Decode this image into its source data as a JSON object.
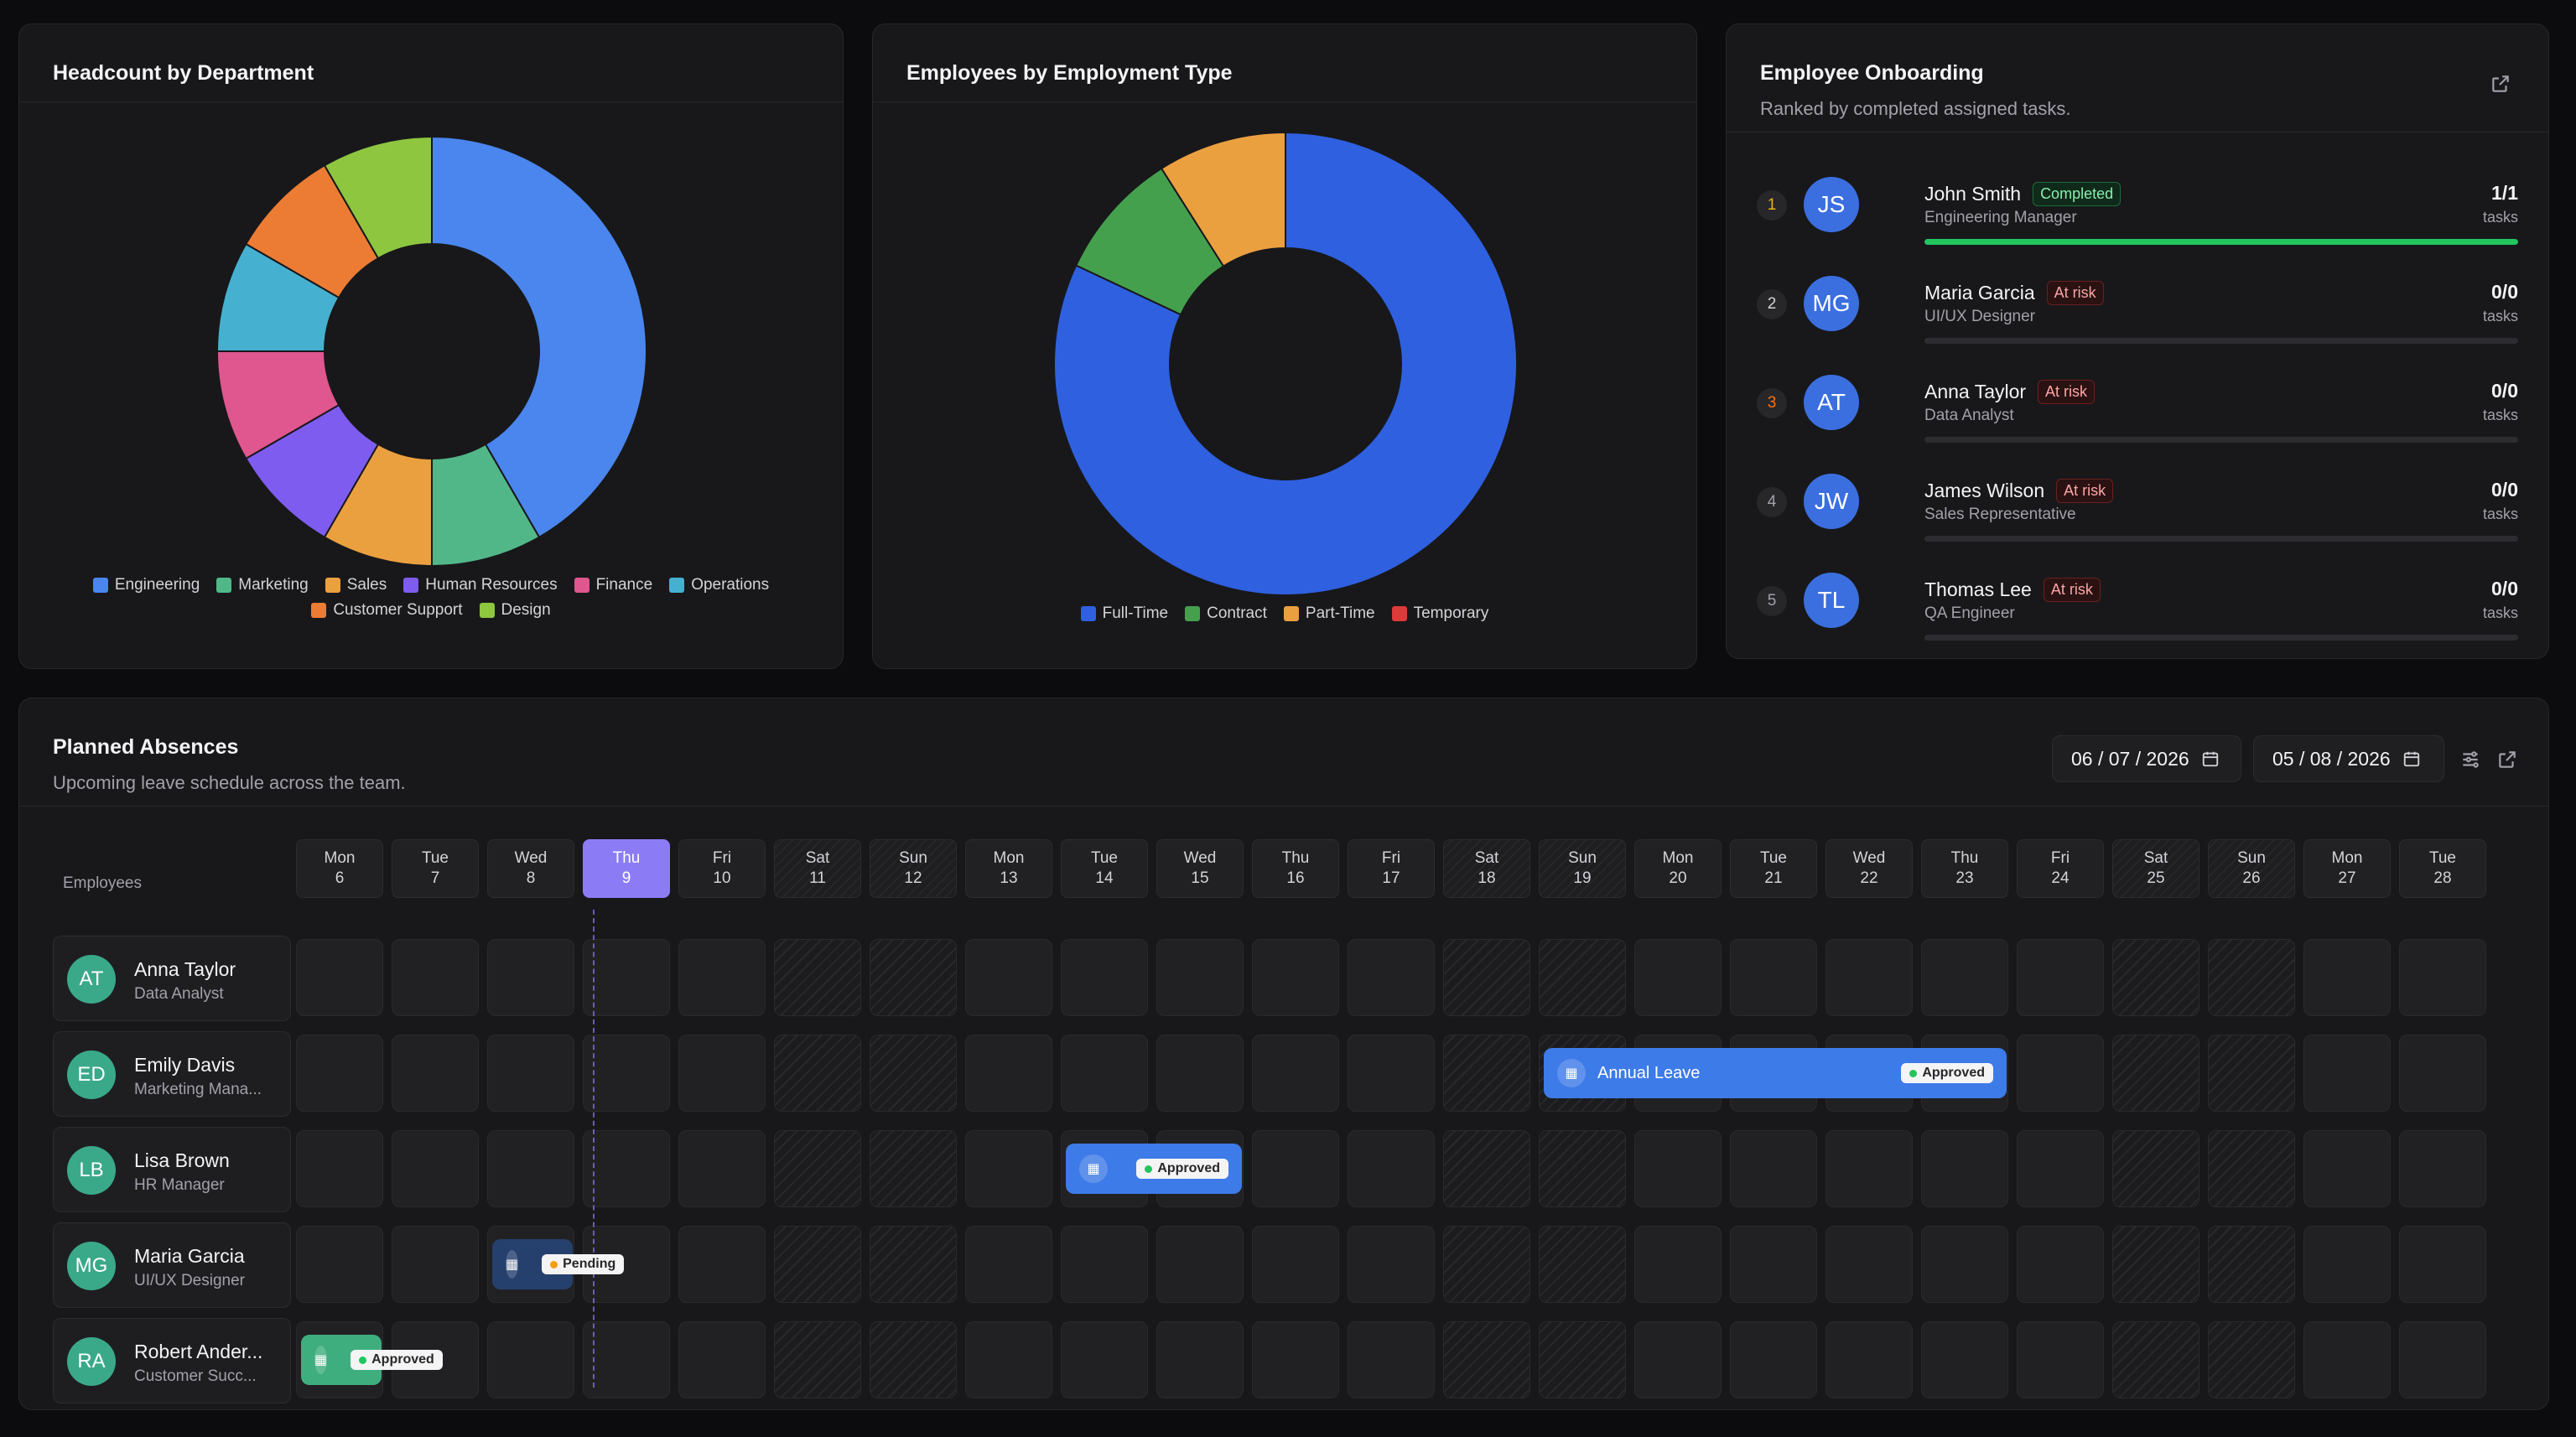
{
  "headcount": {
    "title": "Headcount by Department",
    "legend": [
      {
        "label": "Engineering",
        "color": "#4a86ee"
      },
      {
        "label": "Marketing",
        "color": "#52b788"
      },
      {
        "label": "Sales",
        "color": "#eba040"
      },
      {
        "label": "Human Resources",
        "color": "#7f5cf0"
      },
      {
        "label": "Finance",
        "color": "#e0568e"
      },
      {
        "label": "Operations",
        "color": "#46b0d0"
      },
      {
        "label": "Customer Support",
        "color": "#ec7c34"
      },
      {
        "label": "Design",
        "color": "#8ec640"
      }
    ]
  },
  "employment": {
    "title": "Employees by Employment Type",
    "legend": [
      {
        "label": "Full-Time",
        "color": "#2f60e0"
      },
      {
        "label": "Contract",
        "color": "#45a04e"
      },
      {
        "label": "Part-Time",
        "color": "#eba040"
      },
      {
        "label": "Temporary",
        "color": "#dd3a3a"
      }
    ]
  },
  "chart_data": [
    {
      "type": "pie",
      "title": "Headcount by Department",
      "categories": [
        "Engineering",
        "Marketing",
        "Sales",
        "Human Resources",
        "Finance",
        "Operations",
        "Customer Support",
        "Design"
      ],
      "values": [
        40,
        8,
        8,
        8,
        8,
        8,
        8,
        8
      ],
      "colors": [
        "#4a86ee",
        "#52b788",
        "#eba040",
        "#7f5cf0",
        "#e0568e",
        "#46b0d0",
        "#ec7c34",
        "#8ec640"
      ],
      "legend": "bottom"
    },
    {
      "type": "pie",
      "title": "Employees by Employment Type",
      "categories": [
        "Full-Time",
        "Contract",
        "Part-Time",
        "Temporary"
      ],
      "values": [
        82,
        9,
        9,
        0
      ],
      "colors": [
        "#2f60e0",
        "#45a04e",
        "#eba040",
        "#dd3a3a"
      ],
      "legend": "bottom"
    }
  ],
  "onboarding": {
    "title": "Employee Onboarding",
    "subtitle": "Ranked by completed assigned tasks.",
    "rows": [
      {
        "rank": "1",
        "initials": "JS",
        "name": "John Smith",
        "badge": "Completed",
        "badge_type": "ok",
        "role": "Engineering Manager",
        "count": "1/1",
        "tasks": "tasks",
        "progress": 1.0,
        "rank_color": "#eab308"
      },
      {
        "rank": "2",
        "initials": "MG",
        "name": "Maria Garcia",
        "badge": "At risk",
        "badge_type": "risk",
        "role": "UI/UX Designer",
        "count": "0/0",
        "tasks": "tasks",
        "progress": 0,
        "rank_color": "#d4d4d8"
      },
      {
        "rank": "3",
        "initials": "AT",
        "name": "Anna Taylor",
        "badge": "At risk",
        "badge_type": "risk",
        "role": "Data Analyst",
        "count": "0/0",
        "tasks": "tasks",
        "progress": 0,
        "rank_color": "#f97316"
      },
      {
        "rank": "4",
        "initials": "JW",
        "name": "James Wilson",
        "badge": "At risk",
        "badge_type": "risk",
        "role": "Sales Representative",
        "count": "0/0",
        "tasks": "tasks",
        "progress": 0,
        "rank_color": "#a1a1aa"
      },
      {
        "rank": "5",
        "initials": "TL",
        "name": "Thomas Lee",
        "badge": "At risk",
        "badge_type": "risk",
        "role": "QA Engineer",
        "count": "0/0",
        "tasks": "tasks",
        "progress": 0,
        "rank_color": "#a1a1aa"
      }
    ]
  },
  "absences": {
    "title": "Planned Absences",
    "subtitle": "Upcoming leave schedule across the team.",
    "start_date": "06 / 07 / 2026",
    "end_date": "05 / 08 / 2026",
    "employees_label": "Employees",
    "days": [
      {
        "dow": "Mon",
        "num": "6",
        "weekend": false,
        "today": false
      },
      {
        "dow": "Tue",
        "num": "7",
        "weekend": false,
        "today": false
      },
      {
        "dow": "Wed",
        "num": "8",
        "weekend": false,
        "today": false
      },
      {
        "dow": "Thu",
        "num": "9",
        "weekend": false,
        "today": true
      },
      {
        "dow": "Fri",
        "num": "10",
        "weekend": false,
        "today": false
      },
      {
        "dow": "Sat",
        "num": "11",
        "weekend": true,
        "today": false
      },
      {
        "dow": "Sun",
        "num": "12",
        "weekend": true,
        "today": false
      },
      {
        "dow": "Mon",
        "num": "13",
        "weekend": false,
        "today": false
      },
      {
        "dow": "Tue",
        "num": "14",
        "weekend": false,
        "today": false
      },
      {
        "dow": "Wed",
        "num": "15",
        "weekend": false,
        "today": false
      },
      {
        "dow": "Thu",
        "num": "16",
        "weekend": false,
        "today": false
      },
      {
        "dow": "Fri",
        "num": "17",
        "weekend": false,
        "today": false
      },
      {
        "dow": "Sat",
        "num": "18",
        "weekend": true,
        "today": false
      },
      {
        "dow": "Sun",
        "num": "19",
        "weekend": true,
        "today": false
      },
      {
        "dow": "Mon",
        "num": "20",
        "weekend": false,
        "today": false
      },
      {
        "dow": "Tue",
        "num": "21",
        "weekend": false,
        "today": false
      },
      {
        "dow": "Wed",
        "num": "22",
        "weekend": false,
        "today": false
      },
      {
        "dow": "Thu",
        "num": "23",
        "weekend": false,
        "today": false
      },
      {
        "dow": "Fri",
        "num": "24",
        "weekend": false,
        "today": false
      },
      {
        "dow": "Sat",
        "num": "25",
        "weekend": true,
        "today": false
      },
      {
        "dow": "Sun",
        "num": "26",
        "weekend": true,
        "today": false
      },
      {
        "dow": "Mon",
        "num": "27",
        "weekend": false,
        "today": false
      },
      {
        "dow": "Tue",
        "num": "28",
        "weekend": false,
        "today": false
      }
    ],
    "employees": [
      {
        "initials": "AT",
        "name": "Anna Taylor",
        "role": "Data Analyst"
      },
      {
        "initials": "ED",
        "name": "Emily Davis",
        "role": "Marketing Mana..."
      },
      {
        "initials": "LB",
        "name": "Lisa Brown",
        "role": "HR Manager"
      },
      {
        "initials": "MG",
        "name": "Maria Garcia",
        "role": "UI/UX Designer"
      },
      {
        "initials": "RA",
        "name": "Robert Ander...",
        "role": "Customer Succ..."
      }
    ],
    "leaves": [
      {
        "row": 1,
        "start": 13,
        "span": 5,
        "label": "Annual Leave",
        "status": "Approved",
        "color": "#3d7be8",
        "dot": "#22c55e"
      },
      {
        "row": 2,
        "start": 8,
        "span": 2,
        "label": "",
        "status": "Approved",
        "color": "#3d7be8",
        "dot": "#22c55e"
      },
      {
        "row": 3,
        "start": 2,
        "span": 1,
        "label": "",
        "status": "Pending",
        "color": "#26406e",
        "dot": "#f59e0b"
      },
      {
        "row": 4,
        "start": 0,
        "span": 1,
        "label": "",
        "status": "Approved",
        "color": "#3fae7e",
        "dot": "#22c55e"
      }
    ]
  }
}
